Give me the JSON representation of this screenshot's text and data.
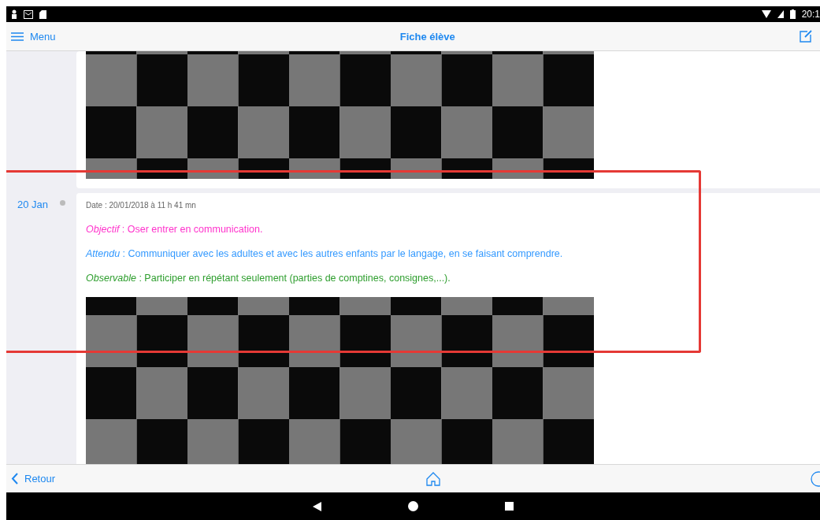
{
  "status_bar": {
    "time": "20:1"
  },
  "nav_bar": {
    "menu": "Menu",
    "title": "Fiche élève"
  },
  "entries": [
    {
      "day": "20 Jan",
      "meta": "Date : 20/01/2018 à 11 h 41 mn",
      "notes": [
        {
          "text": "*Objectif* : Oser entrer en communication.",
          "color": "#ff33cc"
        },
        {
          "text": "*Attendu* : Communiquer avec les adultes et avec les autres enfants par le langage, en se faisant comprendre.",
          "color": "#3399ff"
        },
        {
          "text": "*Observable* : Participer en répétant seulement (parties de comptines, consignes,...).",
          "color": "#2e9e2e"
        }
      ]
    }
  ],
  "toolbar": {
    "back": "Retour"
  }
}
